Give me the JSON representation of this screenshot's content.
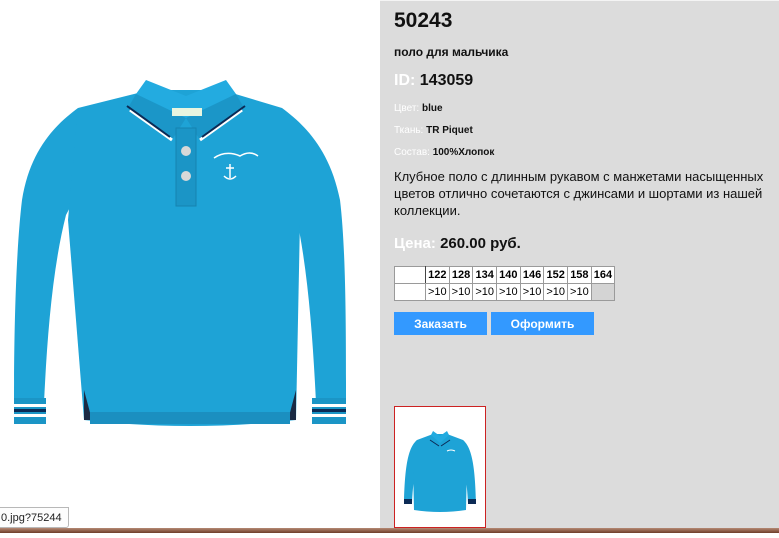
{
  "product": {
    "article": "50243",
    "subtitle": "поло для мальчика",
    "id_label": "ID:",
    "id_value": "143059",
    "color_label": "Цвет:",
    "color_value": "blue",
    "fabric_label": "Ткань:",
    "fabric_value": "TR Piquet",
    "composition_label": "Состав:",
    "composition_value": "100%Хлопок",
    "description": "Клубное поло с длинным рукавом с манжетами насыщенных цветов отлично сочетаются с джинсами и шортами из нашей коллекции.",
    "price_label": "Цена:",
    "price_value": "260.00 руб."
  },
  "sizes": {
    "headers": [
      "122",
      "128",
      "134",
      "140",
      "146",
      "152",
      "158",
      "164"
    ],
    "stock": [
      ">10",
      ">10",
      ">10",
      ">10",
      ">10",
      ">10",
      ">10",
      ""
    ]
  },
  "buttons": {
    "order": "Заказать",
    "checkout": "Оформить"
  },
  "status_url": "0.jpg?75244",
  "colors": {
    "accent": "#3399ff",
    "panel": "#dcdcdc",
    "shirt": "#1ea3d6",
    "thumb_border": "#cc2222"
  }
}
